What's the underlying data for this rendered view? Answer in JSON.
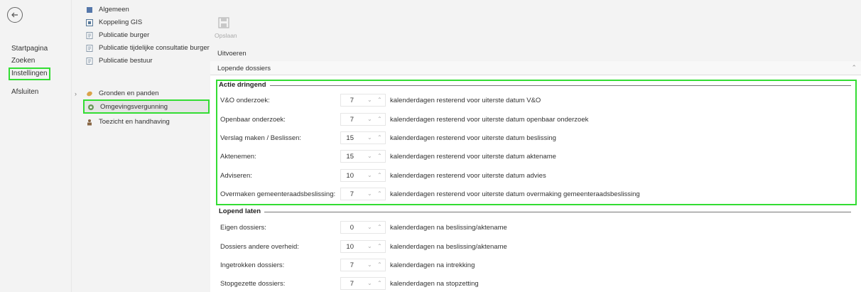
{
  "nav": {
    "items": [
      {
        "label": "Startpagina"
      },
      {
        "label": "Zoeken"
      },
      {
        "label": "Instellingen"
      },
      {
        "label": "Afsluiten"
      }
    ]
  },
  "tree": {
    "items": [
      {
        "label": "Algemeen",
        "icon": "database-icon"
      },
      {
        "label": "Koppeling GIS",
        "icon": "map-icon"
      },
      {
        "label": "Publicatie burger",
        "icon": "document-icon"
      },
      {
        "label": "Publicatie tijdelijke consultatie burger",
        "icon": "document-icon"
      },
      {
        "label": "Publicatie bestuur",
        "icon": "document-icon"
      },
      {
        "label": "Gronden en panden",
        "icon": "parcel-icon"
      },
      {
        "label": "Omgevingsvergunning",
        "icon": "permit-icon"
      },
      {
        "label": "Toezicht en handhaving",
        "icon": "inspector-icon"
      }
    ]
  },
  "ribbon": {
    "save_label": "Opslaan",
    "group_label": "Uitvoeren"
  },
  "section": {
    "title": "Lopende dossiers"
  },
  "groups": [
    {
      "title": "Actie dringend",
      "rows": [
        {
          "label": "V&O onderzoek:",
          "value": "7",
          "suffix": "kalenderdagen resterend voor uiterste datum V&O"
        },
        {
          "label": "Openbaar onderzoek:",
          "value": "7",
          "suffix": "kalenderdagen resterend voor uiterste datum openbaar onderzoek"
        },
        {
          "label": "Verslag maken / Beslissen:",
          "value": "15",
          "suffix": "kalenderdagen resterend voor uiterste datum beslissing"
        },
        {
          "label": "Aktenemen:",
          "value": "15",
          "suffix": "kalenderdagen resterend voor uiterste datum aktename"
        },
        {
          "label": "Adviseren:",
          "value": "10",
          "suffix": "kalenderdagen resterend voor uiterste datum advies"
        },
        {
          "label": "Overmaken gemeenteraadsbeslissing:",
          "value": "7",
          "suffix": "kalenderdagen resterend voor uiterste datum overmaking gemeenteraadsbeslissing"
        }
      ]
    },
    {
      "title": "Lopend laten",
      "rows": [
        {
          "label": "Eigen dossiers:",
          "value": "0",
          "suffix": "kalenderdagen na beslissing/aktename"
        },
        {
          "label": "Dossiers andere overheid:",
          "value": "10",
          "suffix": "kalenderdagen na beslissing/aktename"
        },
        {
          "label": "Ingetrokken dossiers:",
          "value": "7",
          "suffix": "kalenderdagen na intrekking"
        },
        {
          "label": "Stopgezette dossiers:",
          "value": "7",
          "suffix": "kalenderdagen na stopzetting"
        }
      ]
    }
  ],
  "colors": {
    "highlight": "#33dd33",
    "panel": "#f3f3f3"
  }
}
